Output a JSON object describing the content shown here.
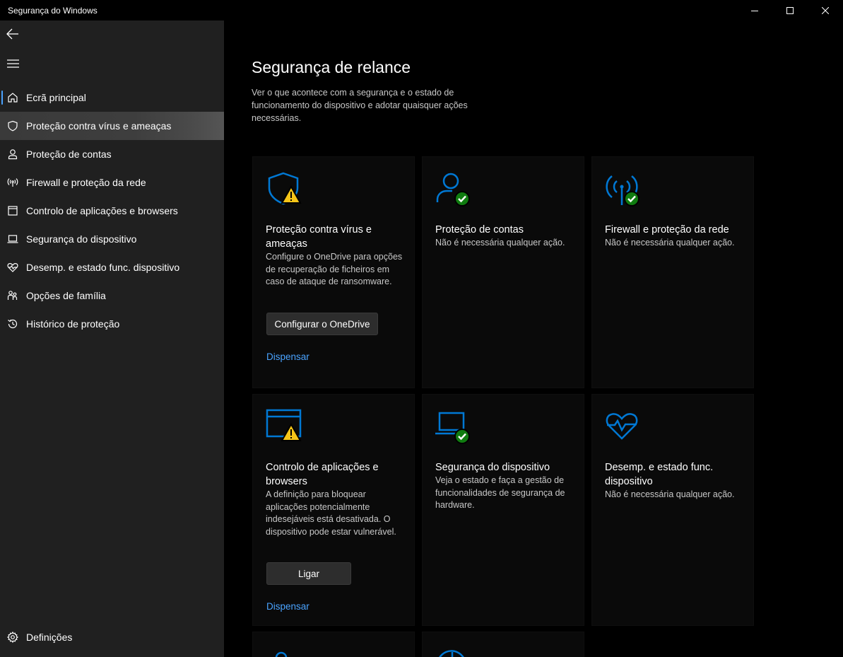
{
  "window": {
    "title": "Segurança do Windows"
  },
  "sidebar": {
    "items": [
      {
        "label": "Ecrã principal",
        "icon": "home-icon"
      },
      {
        "label": "Proteção contra vírus e ameaças",
        "icon": "shield-icon"
      },
      {
        "label": "Proteção de contas",
        "icon": "person-icon"
      },
      {
        "label": "Firewall e proteção da rede",
        "icon": "wifi-antenna-icon"
      },
      {
        "label": "Controlo de aplicações e browsers",
        "icon": "app-window-icon"
      },
      {
        "label": "Segurança do dispositivo",
        "icon": "laptop-icon"
      },
      {
        "label": "Desemp. e estado func. dispositivo",
        "icon": "heart-pulse-icon"
      },
      {
        "label": "Opções de família",
        "icon": "family-icon"
      },
      {
        "label": "Histórico de proteção",
        "icon": "history-icon"
      }
    ],
    "selected_index": 0,
    "settings_label": "Definições"
  },
  "main": {
    "title": "Segurança de relance",
    "description": "Ver o que acontece com a segurança e o estado de funcionamento do dispositivo e adotar quaisquer ações necessárias.",
    "cards": [
      {
        "title": "Proteção contra vírus e ameaças",
        "description": "Configure o OneDrive para opções de recuperação de ficheiros em caso de ataque de ransomware.",
        "button": "Configurar o OneDrive",
        "link": "Dispensar",
        "status": "warning"
      },
      {
        "title": "Proteção de contas",
        "description": "Não é necessária qualquer ação.",
        "status": "ok"
      },
      {
        "title": "Firewall e proteção da rede",
        "description": "Não é necessária qualquer ação.",
        "status": "ok"
      },
      {
        "title": "Controlo de aplicações e browsers",
        "description": "A definição para bloquear aplicações potencialmente indesejáveis está desativada. O dispositivo pode estar vulnerável.",
        "button": "Ligar",
        "link": "Dispensar",
        "status": "warning"
      },
      {
        "title": "Segurança do dispositivo",
        "description": "Veja o estado e faça a gestão de funcionalidades de segurança de hardware.",
        "status": "ok"
      },
      {
        "title": "Desemp. e estado func. dispositivo",
        "description": "Não é necessária qualquer ação.",
        "status": "ok"
      }
    ]
  },
  "colors": {
    "accent_blue": "#0078d4",
    "link_blue": "#4aa3ff",
    "warning_yellow": "#f5c518",
    "ok_green": "#107c10",
    "sidebar_bg": "#202020"
  }
}
